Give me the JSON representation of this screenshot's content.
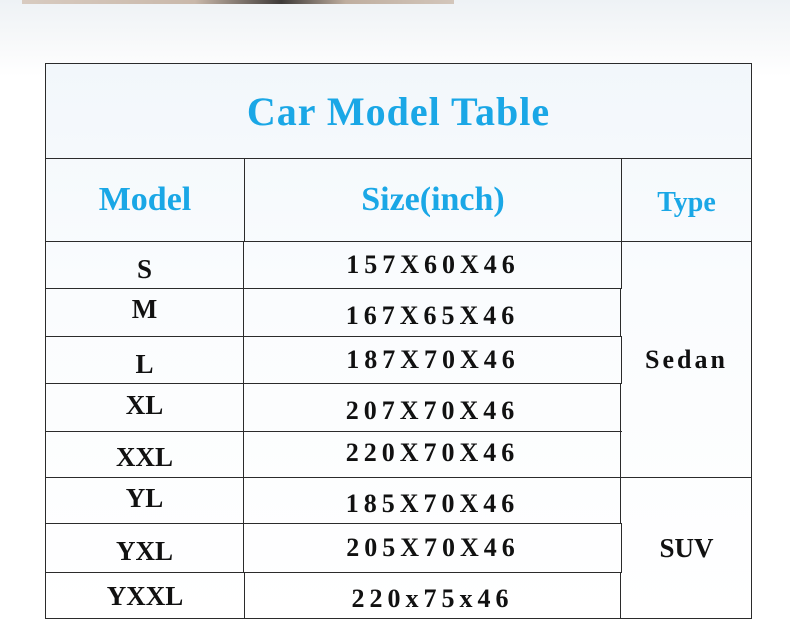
{
  "title": "Car Model Table",
  "headers": {
    "model": "Model",
    "size": "Size(inch)",
    "type": "Type"
  },
  "rows": [
    {
      "model": "S",
      "size": "157X60X46"
    },
    {
      "model": "M",
      "size": "167X65X46"
    },
    {
      "model": "L",
      "size": "187X70X46"
    },
    {
      "model": "XL",
      "size": "207X70X46"
    },
    {
      "model": "XXL",
      "size": "220X70X46"
    },
    {
      "model": "YL",
      "size": "185X70X46"
    },
    {
      "model": "YXL",
      "size": "205X70X46"
    },
    {
      "model": "YXXL",
      "size": "220x75x46"
    }
  ],
  "types": [
    {
      "label": "Sedan"
    },
    {
      "label": "SUV"
    }
  ],
  "colors": {
    "accent": "#1aa7e6",
    "text": "#111111",
    "border": "#2b2b2b"
  }
}
